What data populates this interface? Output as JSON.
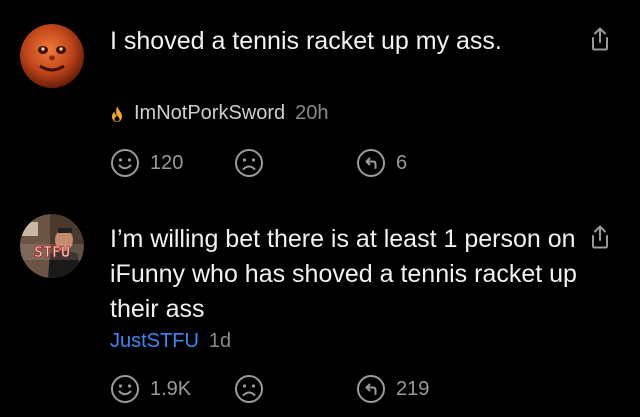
{
  "comments": [
    {
      "text": "I shoved a tennis racket up my ass.",
      "username": "ImNotPorkSword",
      "username_color": "#cfcfcf",
      "badge_icon": "flame-icon",
      "time": "20h",
      "smiles": "120",
      "frowns": "",
      "replies": "6"
    },
    {
      "text": "I’m willing bet there is at least 1 person on iFunny who has shoved a tennis racket up their ass",
      "username": "JustSTFU",
      "username_color": "#3d86f5",
      "time": "1d",
      "smiles": "1.9K",
      "frowns": "",
      "replies": "219",
      "avatar_text": "STFU"
    }
  ],
  "colors": {
    "background": "#000000",
    "icon_gray": "#9a9a9a",
    "flame_orange": "#f5a623",
    "blue_username": "#3d86f5"
  }
}
